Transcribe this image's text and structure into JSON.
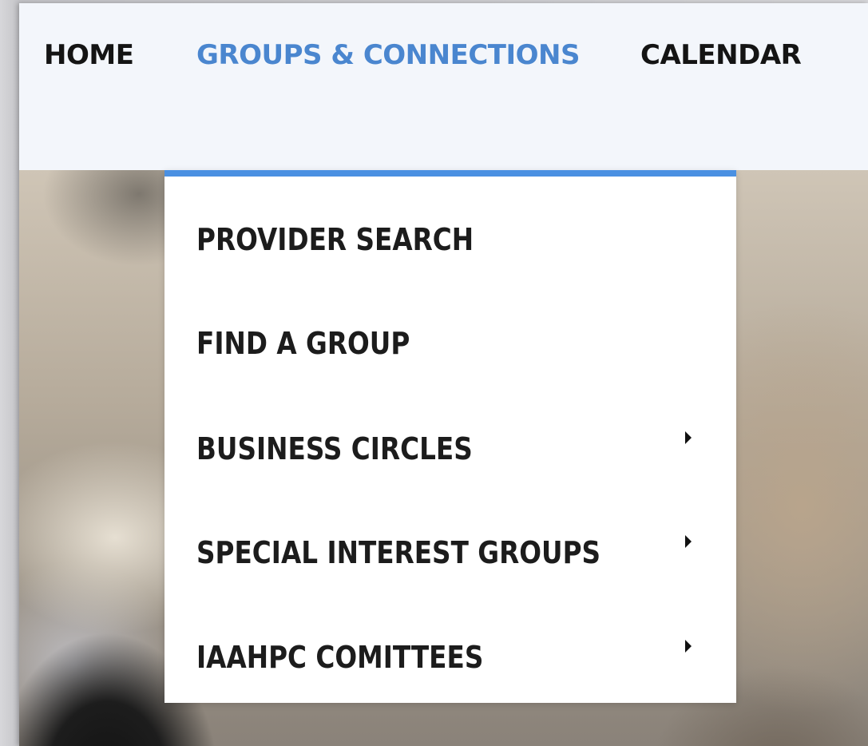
{
  "navbar": {
    "items": [
      {
        "label": "HOME",
        "active": false
      },
      {
        "label": "GROUPS & CONNECTIONS",
        "active": true
      },
      {
        "label": "CALENDAR",
        "active": false
      }
    ],
    "active_color": "#4a86cf"
  },
  "dropdown": {
    "accent_color": "#4a90e2",
    "items": [
      {
        "label": "PROVIDER SEARCH",
        "has_submenu": false
      },
      {
        "label": "FIND A GROUP",
        "has_submenu": false
      },
      {
        "label": "BUSINESS CIRCLES",
        "has_submenu": true,
        "icon": "caret-right-icon"
      },
      {
        "label": "SPECIAL INTEREST GROUPS",
        "has_submenu": true,
        "icon": "caret-right-icon"
      },
      {
        "label": "IAAHPC COMITTEES",
        "has_submenu": true,
        "icon": "caret-right-icon"
      }
    ]
  }
}
